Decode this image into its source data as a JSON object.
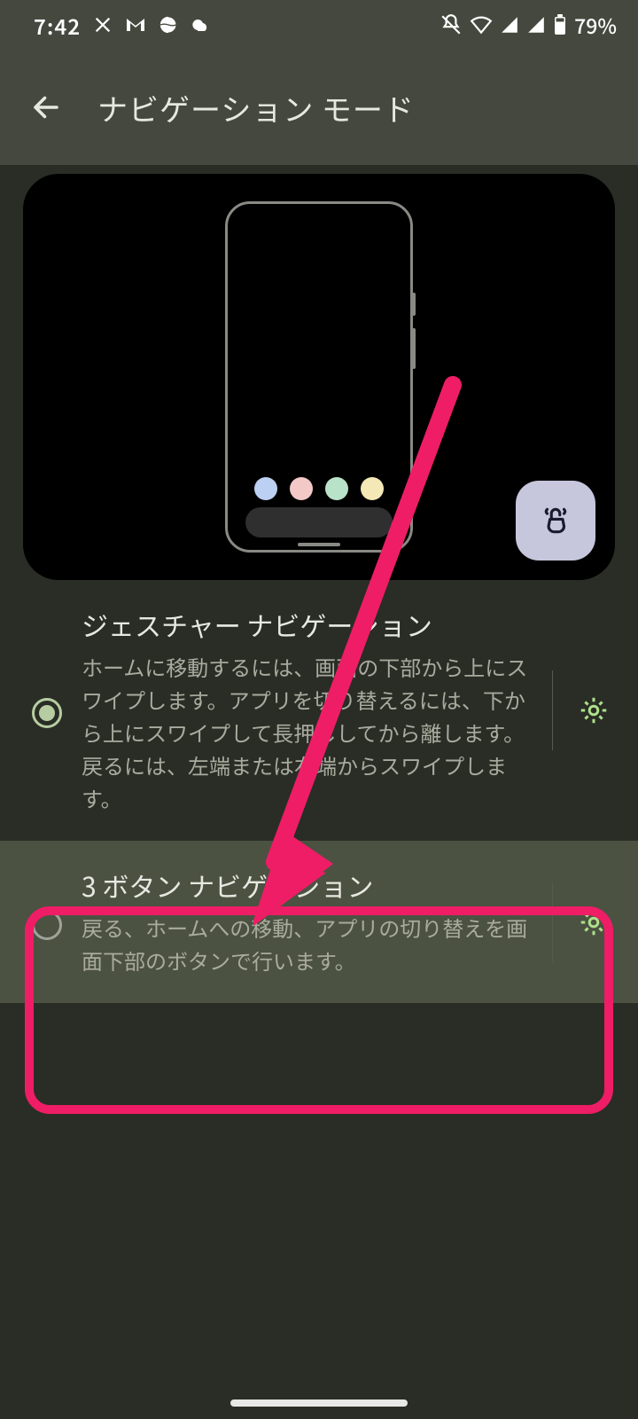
{
  "status": {
    "time": "7:42",
    "battery": "79%"
  },
  "header": {
    "title": "ナビゲーション モード"
  },
  "preview": {
    "dock_colors": [
      "#bcd0f3",
      "#f2c9c7",
      "#b9e3c9",
      "#f4e8b6"
    ]
  },
  "options": [
    {
      "title": "ジェスチャー ナビゲーション",
      "description": "ホームに移動するには、画面の下部から上にスワイプします。アプリを切り替えるには、下から上にスワイプして長押ししてから離します。戻るには、左端または右端からスワイプします。",
      "selected": true
    },
    {
      "title": "3 ボタン ナビゲーション",
      "description": "戻る、ホームへの移動、アプリの切り替えを画面下部のボタンで行います。",
      "selected": false
    }
  ],
  "annotation": {
    "highlight_color": "#ee1d66"
  }
}
